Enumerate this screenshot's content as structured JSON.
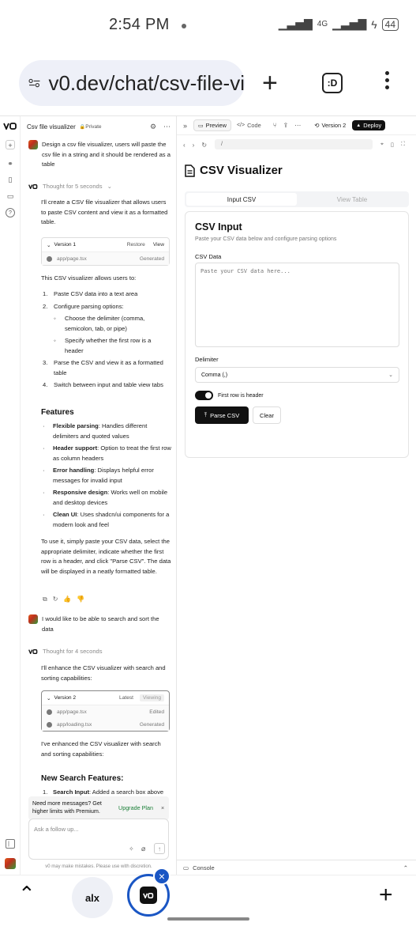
{
  "status": {
    "time": "2:54 PM",
    "network": "4G",
    "battery": "44"
  },
  "browser": {
    "url": "v0.dev/chat/csv-file-vi",
    "tabs_label": ":D"
  },
  "chat": {
    "title": "Csv file visualizer",
    "privacy": "Private",
    "msg1": "Design a csv file visualizer, users will paste the csv file in a string and it should be rendered as a table",
    "thought1": "Thought for 5 seconds",
    "reply1": "I'll create a CSV file visualizer that allows users to paste CSV content and view it as a formatted table.",
    "version1": {
      "label": "Version 1",
      "restore": "Restore",
      "view": "View",
      "file": "app/page.tsx",
      "status": "Generated"
    },
    "allows": "This CSV visualizer allows users to:",
    "steps": [
      "Paste CSV data into a text area",
      "Configure parsing options:",
      "Parse the CSV and view it as a formatted table",
      "Switch between input and table view tabs"
    ],
    "substeps": [
      "Choose the delimiter (comma, semicolon, tab, or pipe)",
      "Specify whether the first row is a header"
    ],
    "features_heading": "Features",
    "features": [
      {
        "title": "Flexible parsing",
        "desc": ": Handles different delimiters and quoted values"
      },
      {
        "title": "Header support",
        "desc": ": Option to treat the first row as column headers"
      },
      {
        "title": "Error handling",
        "desc": ": Displays helpful error messages for invalid input"
      },
      {
        "title": "Responsive design",
        "desc": ": Works well on mobile and desktop devices"
      },
      {
        "title": "Clean UI",
        "desc": ": Uses shadcn/ui components for a modern look and feel"
      }
    ],
    "usage": "To use it, simply paste your CSV data, select the appropriate delimiter, indicate whether the first row is a header, and click \"Parse CSV\". The data will be displayed in a neatly formatted table.",
    "msg2": "I would like to be able to search and sort the data",
    "thought2": "Thought for 4 seconds",
    "reply2": "I'll enhance the CSV visualizer with search and sorting capabilities:",
    "version2": {
      "label": "Version 2",
      "latest": "Latest",
      "viewing": "Viewing",
      "file1": "app/page.tsx",
      "file1_status": "Edited",
      "file2": "app/loading.tsx",
      "file2_status": "Generated"
    },
    "enhanced": "I've enhanced the CSV visualizer with search and sorting capabilities:",
    "new_heading": "New Search Features:",
    "new_item_title": "Search Input",
    "new_item_desc": ": Added a search box above",
    "upsell_text": "Need more messages? Get higher limits with Premium.",
    "upsell_link": "Upgrade Plan",
    "composer_placeholder": "Ask a follow up...",
    "disclaimer": "v0 may make mistakes. Please use with discretion."
  },
  "toolbar": {
    "preview": "Preview",
    "code": "Code",
    "version": "Version 2",
    "deploy": "Deploy",
    "path": "/"
  },
  "app": {
    "title": "CSV Visualizer",
    "tab_input": "Input CSV",
    "tab_table": "View Table",
    "card_title": "CSV Input",
    "card_desc": "Paste your CSV data below and configure parsing options",
    "data_label": "CSV Data",
    "data_placeholder": "Paste your CSV data here...",
    "delimiter_label": "Delimiter",
    "delimiter_value": "Comma (,)",
    "header_toggle": "First row is header",
    "parse_button": "Parse CSV",
    "clear_button": "Clear"
  },
  "console_label": "Console",
  "bottomnav": {
    "tab1": "alx"
  }
}
